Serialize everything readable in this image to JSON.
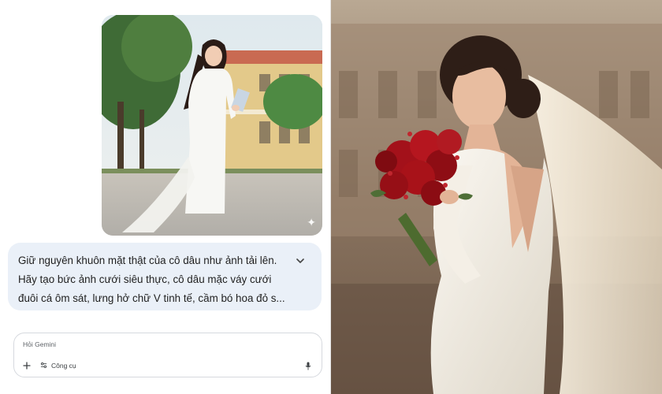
{
  "chat": {
    "uploaded_image": {
      "alt": "Ảnh tải lên",
      "sparkle_icon": "✦"
    },
    "prompt": {
      "text": "Giữ nguyên khuôn mặt thật của cô dâu như ảnh tải lên. Hãy tạo bức ảnh cưới siêu thực, cô dâu mặc váy cưới đuôi cá ôm sát, lưng hở chữ V tinh tế, cầm bó hoa đỏ s...",
      "expand_icon": "chevron-down-icon"
    },
    "input": {
      "placeholder": "Hỏi Gemini",
      "add_icon": "plus-icon",
      "tools_icon": "tools-sliders-icon",
      "tools_label": "Công cụ",
      "mic_icon": "microphone-icon"
    }
  },
  "result": {
    "alt": "Ảnh cưới được tạo"
  },
  "colors": {
    "bubble_bg": "#eaf0f8",
    "border": "#d6d9de",
    "text": "#1f1f1f",
    "muted": "#5f6368"
  }
}
